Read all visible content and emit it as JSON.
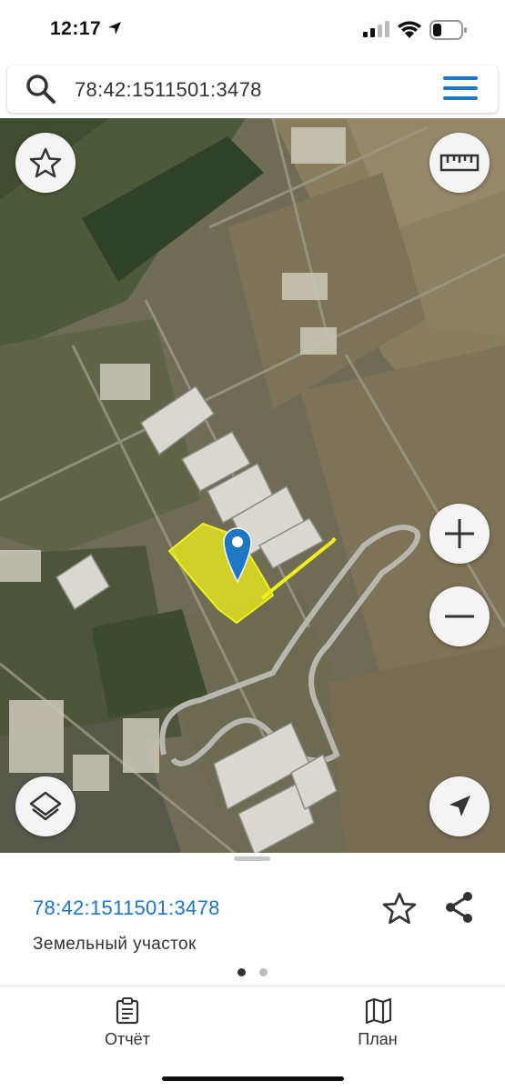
{
  "status_bar": {
    "time": "12:17"
  },
  "search": {
    "value": "78:42:1511501:3478"
  },
  "map": {
    "parcel_color": "#f2f21a",
    "pin_color": "#1f76c2",
    "controls": [
      "favorite-star-icon",
      "ruler-icon",
      "zoom-in-icon",
      "zoom-out-icon",
      "layers-icon",
      "locate-arrow-icon"
    ]
  },
  "sheet": {
    "cadastral_number": "78:42:1511501:3478",
    "object_type": "Земельный участок",
    "page_dots": {
      "count": 2,
      "active": 1
    }
  },
  "tabs": [
    {
      "label": "Отчёт",
      "icon": "report-clipboard-icon"
    },
    {
      "label": "План",
      "icon": "plan-map-icon"
    }
  ],
  "colors": {
    "accent": "#1f76c2",
    "parcel": "#f2f21a"
  }
}
